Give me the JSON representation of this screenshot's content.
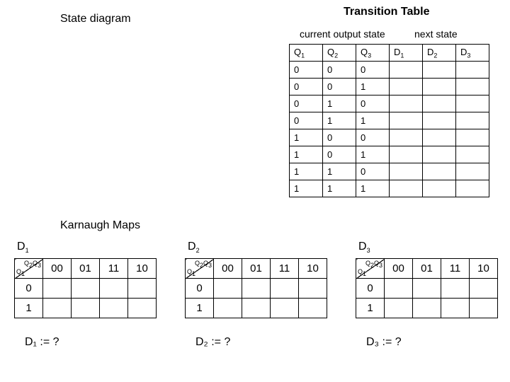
{
  "state_diagram_label": "State diagram",
  "transition": {
    "title": "Transition Table",
    "current_header": "current output state",
    "next_header": "next state",
    "cols": {
      "q1": "Q",
      "q2": "Q",
      "q3": "Q",
      "d1": "D",
      "d2": "D",
      "d3": "D",
      "q1s": "1",
      "q2s": "2",
      "q3s": "3",
      "d1s": "1",
      "d2s": "2",
      "d3s": "3"
    },
    "rows": [
      {
        "q1": "0",
        "q2": "0",
        "q3": "0",
        "d1": "",
        "d2": "",
        "d3": ""
      },
      {
        "q1": "0",
        "q2": "0",
        "q3": "1",
        "d1": "",
        "d2": "",
        "d3": ""
      },
      {
        "q1": "0",
        "q2": "1",
        "q3": "0",
        "d1": "",
        "d2": "",
        "d3": ""
      },
      {
        "q1": "0",
        "q2": "1",
        "q3": "1",
        "d1": "",
        "d2": "",
        "d3": ""
      },
      {
        "q1": "1",
        "q2": "0",
        "q3": "0",
        "d1": "",
        "d2": "",
        "d3": ""
      },
      {
        "q1": "1",
        "q2": "0",
        "q3": "1",
        "d1": "",
        "d2": "",
        "d3": ""
      },
      {
        "q1": "1",
        "q2": "1",
        "q3": "0",
        "d1": "",
        "d2": "",
        "d3": ""
      },
      {
        "q1": "1",
        "q2": "1",
        "q3": "1",
        "d1": "",
        "d2": "",
        "d3": ""
      }
    ]
  },
  "kmaps_label": "Karnaugh Maps",
  "chart_data": {
    "type": "table",
    "kmaps": [
      {
        "name": "D1",
        "corner_top": "Q₂Q₃",
        "corner_bot": "Q₁",
        "col_headers": [
          "00",
          "01",
          "11",
          "10"
        ],
        "row_headers": [
          "0",
          "1"
        ],
        "cells": [
          [
            "",
            "",
            "",
            ""
          ],
          [
            "",
            "",
            "",
            ""
          ]
        ],
        "equation": "D₁ := ?"
      },
      {
        "name": "D2",
        "corner_top": "Q₂Q₃",
        "corner_bot": "Q₁",
        "col_headers": [
          "00",
          "01",
          "11",
          "10"
        ],
        "row_headers": [
          "0",
          "1"
        ],
        "cells": [
          [
            "",
            "",
            "",
            ""
          ],
          [
            "",
            "",
            "",
            ""
          ]
        ],
        "equation": "D₂ := ?"
      },
      {
        "name": "D3",
        "corner_top": "Q₂Q₃",
        "corner_bot": "Q₁",
        "col_headers": [
          "00",
          "01",
          "11",
          "10"
        ],
        "row_headers": [
          "0",
          "1"
        ],
        "cells": [
          [
            "",
            "",
            "",
            ""
          ],
          [
            "",
            "",
            "",
            ""
          ]
        ],
        "equation": "D₃ := ?"
      }
    ]
  },
  "kmap_title_sub": {
    "d1": "1",
    "d2": "2",
    "d3": "3"
  },
  "corner_labels": {
    "top_q2": "Q",
    "top_q2s": "2",
    "top_q3": "Q",
    "top_q3s": "3",
    "bot_q1": "Q",
    "bot_q1s": "1"
  }
}
